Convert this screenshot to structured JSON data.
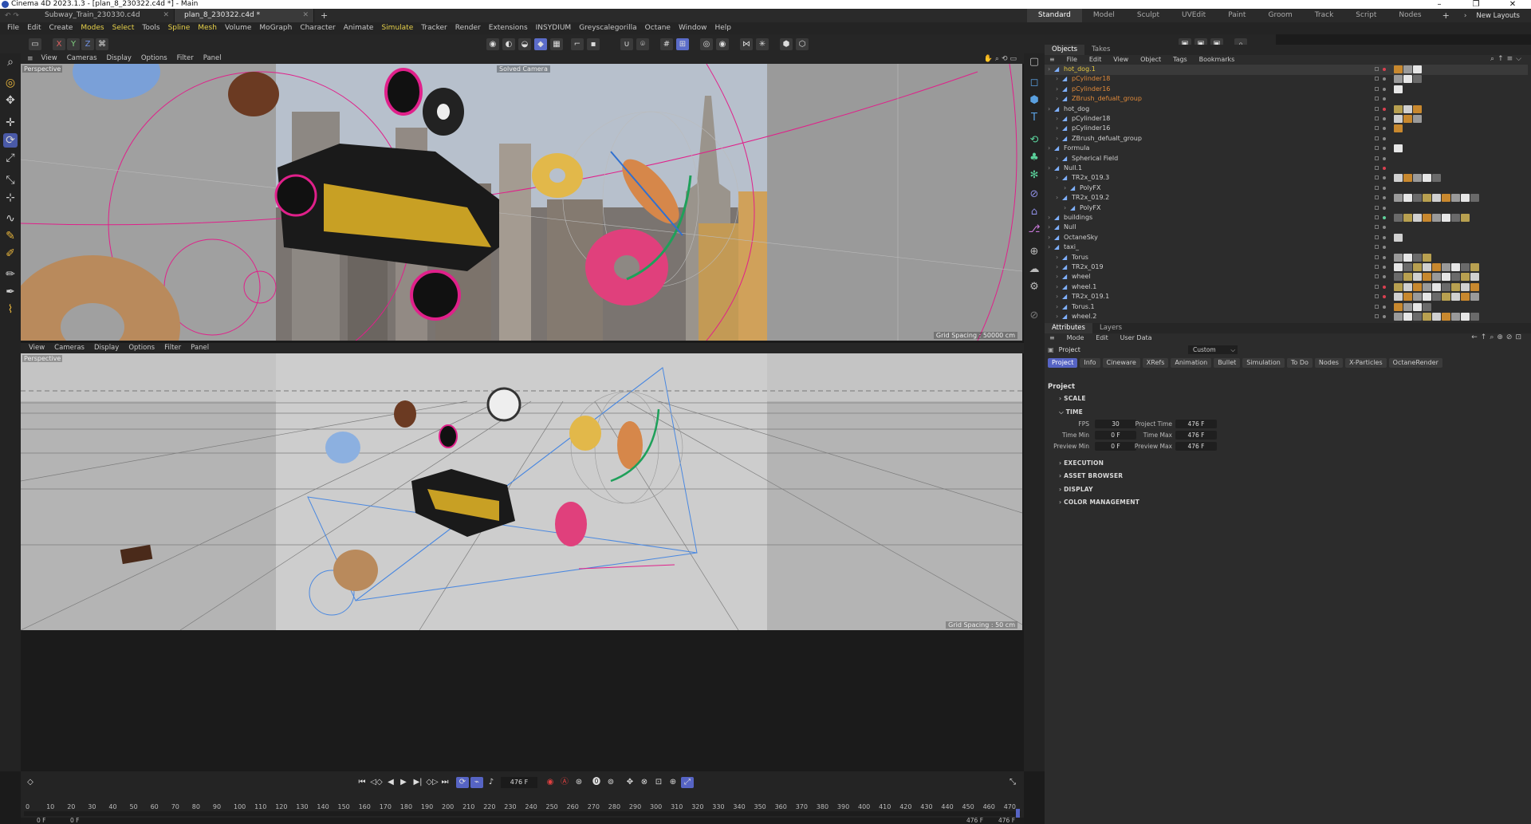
{
  "window": {
    "title": "Cinema 4D 2023.1.3 - [plan_8_230322.c4d *] - Main",
    "minimize": "–",
    "maximize": "❐",
    "close": "✕"
  },
  "doc_tabs": [
    {
      "label": "Subway_Train_230330.c4d"
    },
    {
      "label": "plan_8_230322.c4d *"
    }
  ],
  "new_tab": "+",
  "layouts": [
    "Standard",
    "Model",
    "Sculpt",
    "UVEdit",
    "Paint",
    "Groom",
    "Track",
    "Script",
    "Nodes"
  ],
  "layouts_add": "+",
  "new_layouts": "New Layouts",
  "menus": [
    "File",
    "Edit",
    "Create",
    "Modes",
    "Select",
    "Tools",
    "Spline",
    "Mesh",
    "Volume",
    "MoGraph",
    "Character",
    "Animate",
    "Simulate",
    "Tracker",
    "Render",
    "Extensions",
    "INSYDIUM",
    "Greyscalegorilla",
    "Octane",
    "Window",
    "Help"
  ],
  "highlight_menus": [
    "Modes",
    "Select",
    "Spline",
    "Mesh",
    "Simulate"
  ],
  "axis_buttons": [
    "X",
    "Y",
    "Z"
  ],
  "viewport_top": {
    "menus": [
      "View",
      "Cameras",
      "Display",
      "Options",
      "Filter",
      "Panel"
    ],
    "label": "Perspective",
    "camera": "Solved Camera",
    "grid": "Grid Spacing : 50000 cm"
  },
  "viewport_bottom": {
    "menus": [
      "View",
      "Cameras",
      "Display",
      "Options",
      "Filter",
      "Panel"
    ],
    "label": "Perspective",
    "grid": "Grid Spacing : 50 cm"
  },
  "objects_panel": {
    "tabs": [
      "Objects",
      "Takes"
    ],
    "menus": [
      "File",
      "Edit",
      "View",
      "Object",
      "Tags",
      "Bookmarks"
    ],
    "rows": [
      {
        "name": "hot_dog.1",
        "indent": 0,
        "color": "#e6c840",
        "dot": "#d94050"
      },
      {
        "name": "pCylinder18",
        "indent": 1,
        "color": "#e08a3a",
        "dot": "#888"
      },
      {
        "name": "pCylinder16",
        "indent": 1,
        "color": "#e08a3a",
        "dot": "#888"
      },
      {
        "name": "ZBrush_defualt_group",
        "indent": 1,
        "color": "#e08a3a",
        "dot": "#888"
      },
      {
        "name": "hot_dog",
        "indent": 0,
        "color": "#cfcfcf",
        "dot": "#d94050"
      },
      {
        "name": "pCylinder18",
        "indent": 1,
        "color": "#cfcfcf",
        "dot": "#888"
      },
      {
        "name": "pCylinder16",
        "indent": 1,
        "color": "#cfcfcf",
        "dot": "#888"
      },
      {
        "name": "ZBrush_defualt_group",
        "indent": 1,
        "color": "#cfcfcf",
        "dot": "#888"
      },
      {
        "name": "Formula",
        "indent": 0,
        "color": "#cfcfcf",
        "dot": "#888"
      },
      {
        "name": "Spherical Field",
        "indent": 1,
        "color": "#cfcfcf",
        "dot": "#888"
      },
      {
        "name": "Null.1",
        "indent": 0,
        "color": "#cfcfcf",
        "dot": "#d94050"
      },
      {
        "name": "TR2x_019.3",
        "indent": 1,
        "color": "#cfcfcf",
        "dot": "#888"
      },
      {
        "name": "PolyFX",
        "indent": 2,
        "color": "#cfcfcf",
        "dot": "#888"
      },
      {
        "name": "TR2x_019.2",
        "indent": 1,
        "color": "#cfcfcf",
        "dot": "#888"
      },
      {
        "name": "PolyFX",
        "indent": 2,
        "color": "#cfcfcf",
        "dot": "#888"
      },
      {
        "name": "buildings",
        "indent": 0,
        "color": "#cfcfcf",
        "dot": "#5fd09a"
      },
      {
        "name": "Null",
        "indent": 0,
        "color": "#cfcfcf",
        "dot": "#888"
      },
      {
        "name": "OctaneSky",
        "indent": 0,
        "color": "#cfcfcf",
        "dot": "#888"
      },
      {
        "name": "taxi_",
        "indent": 0,
        "color": "#cfcfcf",
        "dot": "#888"
      },
      {
        "name": "Torus",
        "indent": 1,
        "color": "#cfcfcf",
        "dot": "#888"
      },
      {
        "name": "TR2x_019",
        "indent": 1,
        "color": "#cfcfcf",
        "dot": "#888"
      },
      {
        "name": "wheel",
        "indent": 1,
        "color": "#cfcfcf",
        "dot": "#888"
      },
      {
        "name": "wheel.1",
        "indent": 1,
        "color": "#cfcfcf",
        "dot": "#d94050"
      },
      {
        "name": "TR2x_019.1",
        "indent": 1,
        "color": "#cfcfcf",
        "dot": "#d94050"
      },
      {
        "name": "Torus.1",
        "indent": 1,
        "color": "#cfcfcf",
        "dot": "#888"
      },
      {
        "name": "wheel.2",
        "indent": 1,
        "color": "#cfcfcf",
        "dot": "#888"
      }
    ]
  },
  "attributes_panel": {
    "tabs": [
      "Attributes",
      "Layers"
    ],
    "menus": [
      "Mode",
      "Edit",
      "User Data"
    ],
    "object_label": "Project",
    "preset": "Custom",
    "tabs_row": [
      "Project",
      "Info",
      "Cineware",
      "XRefs",
      "Animation",
      "Bullet",
      "Simulation",
      "To Do",
      "Nodes",
      "X-Particles",
      "OctaneRender"
    ],
    "section_title": "Project",
    "sections": [
      "SCALE",
      "TIME",
      "EXECUTION",
      "ASSET BROWSER",
      "DISPLAY",
      "COLOR MANAGEMENT"
    ],
    "time_fields": {
      "fps_label": "FPS",
      "fps": "30",
      "project_time_label": "Project Time",
      "project_time": "476 F",
      "time_min_label": "Time Min",
      "time_min": "0 F",
      "time_max_label": "Time Max",
      "time_max": "476 F",
      "preview_min_label": "Preview Min",
      "preview_min": "0 F",
      "preview_max_label": "Preview Max",
      "preview_max": "476 F"
    }
  },
  "timeline": {
    "current_frame": "476 F",
    "ticks": [
      "0",
      "10",
      "20",
      "30",
      "40",
      "50",
      "60",
      "70",
      "80",
      "90",
      "100",
      "110",
      "120",
      "130",
      "140",
      "150",
      "160",
      "170",
      "180",
      "190",
      "200",
      "210",
      "220",
      "230",
      "240",
      "250",
      "260",
      "270",
      "280",
      "290",
      "300",
      "310",
      "320",
      "330",
      "340",
      "350",
      "360",
      "370",
      "380",
      "390",
      "400",
      "410",
      "420",
      "430",
      "440",
      "450",
      "460",
      "470"
    ],
    "start_a": "0 F",
    "start_b": "0 F",
    "end_a": "476 F",
    "end_b": "476 F"
  },
  "colors": {
    "accent": "#5664c4",
    "selection_pink": "#e0208a",
    "warn_orange": "#e08a3a"
  }
}
